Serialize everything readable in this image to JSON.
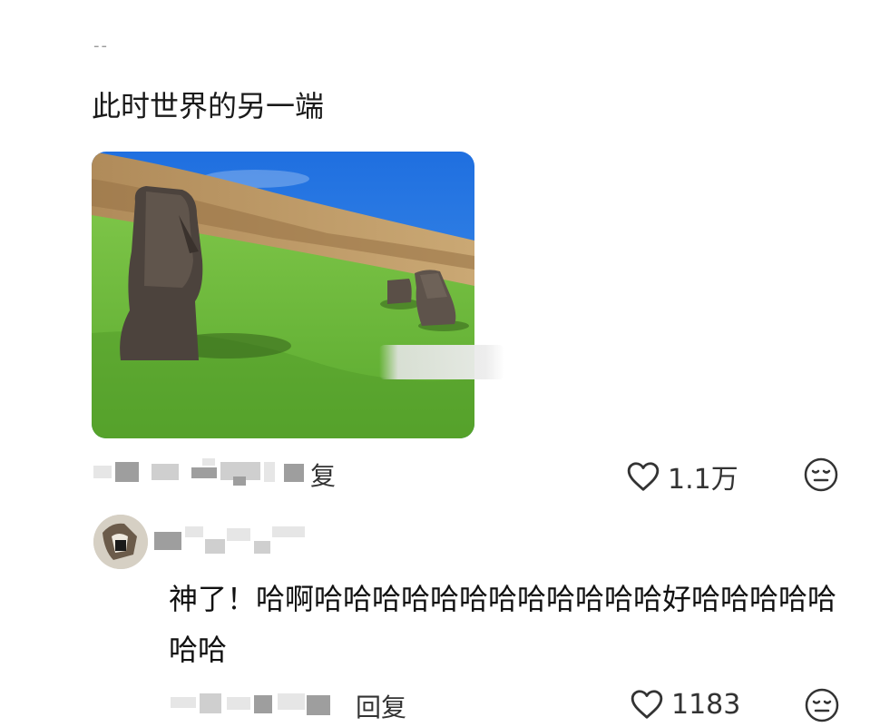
{
  "post": {
    "author_stub": "--",
    "text": "此时世界的另一端",
    "image_alt": "Moai statues on a grassy hillside",
    "meta_reply": "复",
    "like_count": "1.1万"
  },
  "comment": {
    "text": "神了！哈啊哈哈哈哈哈哈哈哈哈哈哈哈好哈哈哈哈哈哈哈",
    "reply_label": "回复",
    "like_count": "1183"
  },
  "colors": {
    "sky": "#2f7fe0",
    "grass": "#6cb93a",
    "text": "#1a1a1a"
  }
}
